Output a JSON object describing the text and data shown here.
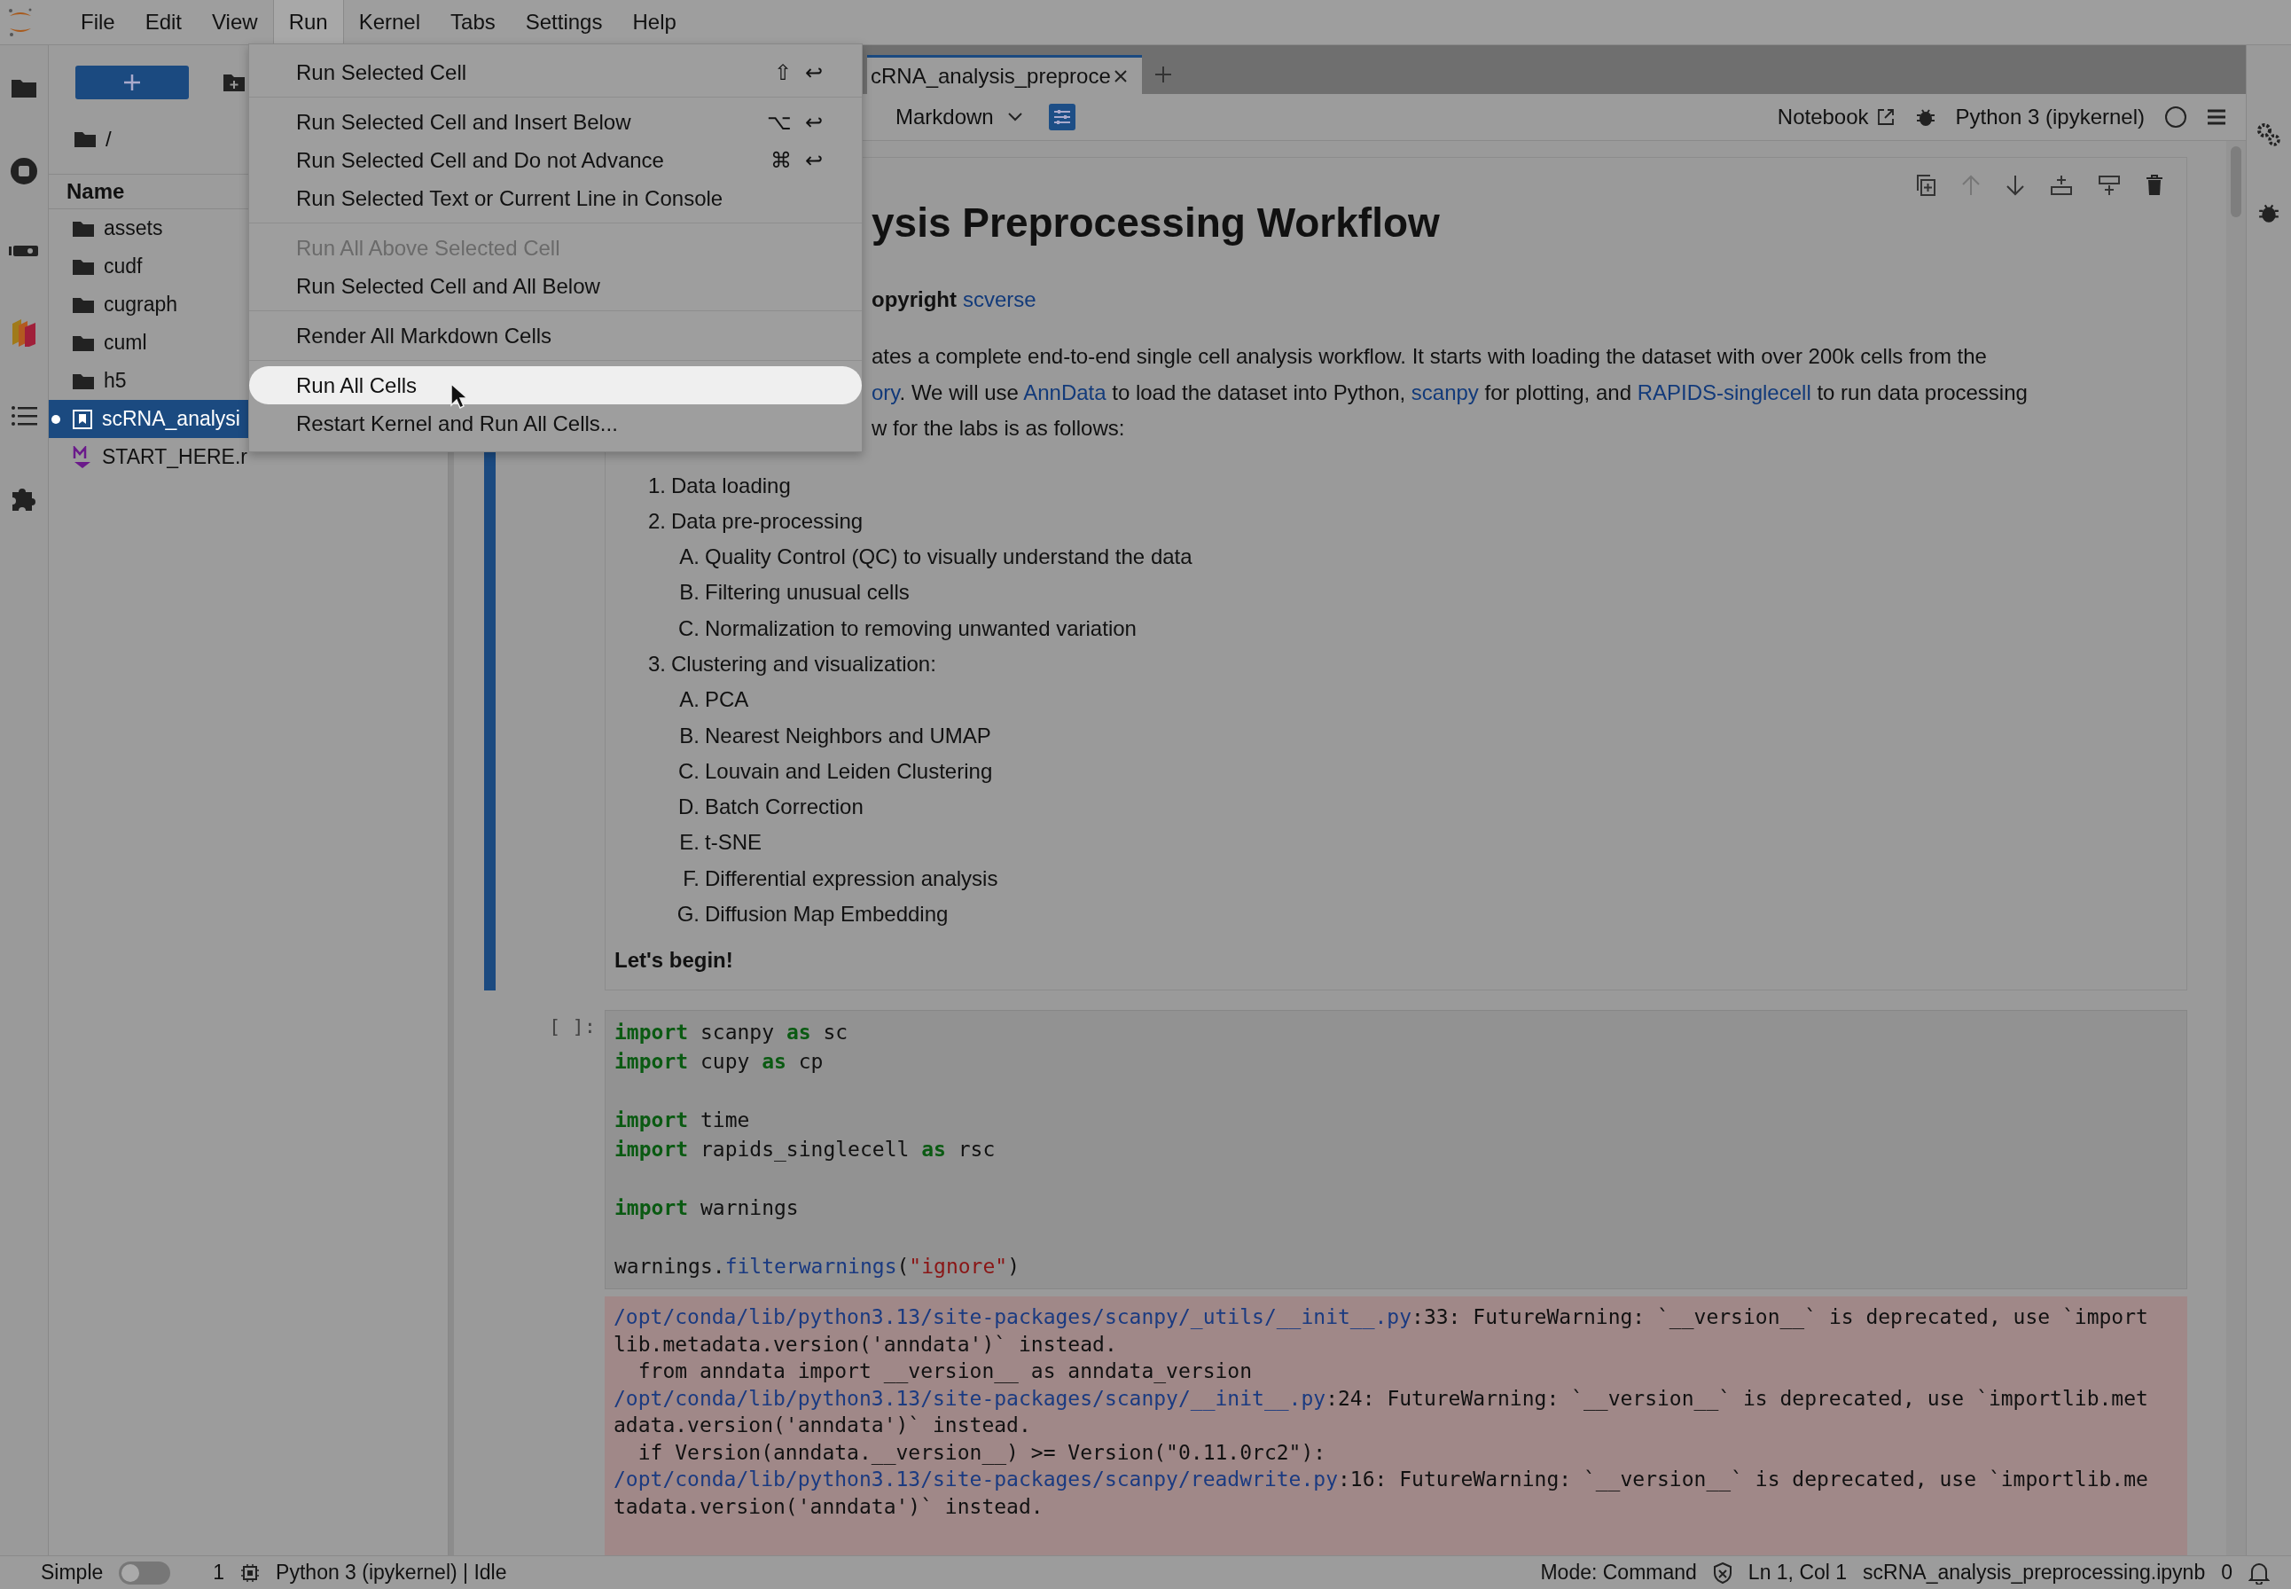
{
  "menubar": {
    "items": [
      {
        "label": "File",
        "selected": false
      },
      {
        "label": "Edit",
        "selected": false
      },
      {
        "label": "View",
        "selected": false
      },
      {
        "label": "Run",
        "selected": true
      },
      {
        "label": "Kernel",
        "selected": false
      },
      {
        "label": "Tabs",
        "selected": false
      },
      {
        "label": "Settings",
        "selected": false
      },
      {
        "label": "Help",
        "selected": false
      }
    ]
  },
  "run_menu": {
    "groups": [
      {
        "items": [
          {
            "label": "Run Selected Cell",
            "shortcut": "⇧ ↩",
            "disabled": false,
            "selected": false
          }
        ]
      },
      {
        "items": [
          {
            "label": "Run Selected Cell and Insert Below",
            "shortcut": "⌥ ↩",
            "disabled": false,
            "selected": false
          },
          {
            "label": "Run Selected Cell and Do not Advance",
            "shortcut": "⌘ ↩",
            "disabled": false,
            "selected": false
          },
          {
            "label": "Run Selected Text or Current Line in Console",
            "disabled": false,
            "selected": false
          }
        ]
      },
      {
        "items": [
          {
            "label": "Run All Above Selected Cell",
            "disabled": true,
            "selected": false
          },
          {
            "label": "Run Selected Cell and All Below",
            "disabled": false,
            "selected": false
          }
        ]
      },
      {
        "items": [
          {
            "label": "Render All Markdown Cells",
            "disabled": false,
            "selected": false
          }
        ]
      },
      {
        "items": [
          {
            "label": "Run All Cells",
            "disabled": false,
            "selected": true
          },
          {
            "label": "Restart Kernel and Run All Cells...",
            "disabled": false,
            "selected": false
          }
        ]
      }
    ]
  },
  "file_browser": {
    "path": "/",
    "column": "Name",
    "items": [
      {
        "name": "assets",
        "kind": "folder",
        "selected": false
      },
      {
        "name": "cudf",
        "kind": "folder",
        "selected": false
      },
      {
        "name": "cugraph",
        "kind": "folder",
        "selected": false
      },
      {
        "name": "cuml",
        "kind": "folder",
        "selected": false
      },
      {
        "name": "h5",
        "kind": "folder",
        "selected": false
      },
      {
        "name": "scRNA_analysi",
        "kind": "notebook",
        "selected": true
      },
      {
        "name": "START_HERE.r",
        "kind": "markdown",
        "selected": false
      }
    ]
  },
  "tab": {
    "title": "cRNA_analysis_preproce"
  },
  "toolbar": {
    "cell_type": "Markdown",
    "notebook_label": "Notebook",
    "kernel": "Python 3 (ipykernel)"
  },
  "markdown_cell": {
    "heading": "ysis Preprocessing Workflow",
    "copyright": [
      {
        "text": "opyright",
        "kind": "bold"
      },
      {
        "text": "scverse",
        "kind": "link"
      }
    ],
    "paragraph_lines": [
      [
        {
          "text": "ates a complete end-to-end single cell analysis workflow. It starts with loading the dataset with over 200k cells from the",
          "kind": "text"
        }
      ],
      [
        {
          "text": "ory",
          "kind": "link"
        },
        {
          "text": ". We will use ",
          "kind": "text"
        },
        {
          "text": "AnnData",
          "kind": "link"
        },
        {
          "text": " to load the dataset into Python, ",
          "kind": "text"
        },
        {
          "text": "scanpy",
          "kind": "link"
        },
        {
          "text": " for plotting, and ",
          "kind": "text"
        },
        {
          "text": "RAPIDS-singlecell",
          "kind": "link"
        },
        {
          "text": " to run data processing",
          "kind": "text"
        }
      ],
      [
        {
          "text": "w for the labs is as follows:",
          "kind": "text"
        }
      ]
    ],
    "list": [
      {
        "marker": "1.",
        "text": "Data loading"
      },
      {
        "marker": "2.",
        "text": "Data pre-processing",
        "children": [
          {
            "marker": "A.",
            "text": "Quality Control (QC) to visually understand the data"
          },
          {
            "marker": "B.",
            "text": "Filtering unusual cells"
          },
          {
            "marker": "C.",
            "text": "Normalization to removing unwanted variation"
          }
        ]
      },
      {
        "marker": "3.",
        "text": "Clustering and visualization:",
        "children": [
          {
            "marker": "A.",
            "text": "PCA"
          },
          {
            "marker": "B.",
            "text": "Nearest Neighbors and UMAP"
          },
          {
            "marker": "C.",
            "text": "Louvain and Leiden Clustering"
          },
          {
            "marker": "D.",
            "text": "Batch Correction"
          },
          {
            "marker": "E.",
            "text": "t-SNE"
          },
          {
            "marker": "F.",
            "text": "Differential expression analysis"
          },
          {
            "marker": "G.",
            "text": "Diffusion Map Embedding"
          }
        ]
      }
    ],
    "closing": "Let's begin!"
  },
  "code_cell": {
    "prompt": "[ ]:",
    "lines": [
      {
        "gap_before": false,
        "tokens": [
          {
            "text": "import",
            "kind": "keyword"
          },
          {
            "text": " scanpy ",
            "kind": "plain"
          },
          {
            "text": "as",
            "kind": "keyword"
          },
          {
            "text": " sc",
            "kind": "plain"
          }
        ]
      },
      {
        "gap_before": false,
        "tokens": [
          {
            "text": "import",
            "kind": "keyword"
          },
          {
            "text": " cupy ",
            "kind": "plain"
          },
          {
            "text": "as",
            "kind": "keyword"
          },
          {
            "text": " cp",
            "kind": "plain"
          }
        ]
      },
      {
        "gap_before": true,
        "tokens": [
          {
            "text": "import",
            "kind": "keyword"
          },
          {
            "text": " time",
            "kind": "plain"
          }
        ]
      },
      {
        "gap_before": false,
        "tokens": [
          {
            "text": "import",
            "kind": "keyword"
          },
          {
            "text": " rapids_singlecell ",
            "kind": "plain"
          },
          {
            "text": "as",
            "kind": "keyword"
          },
          {
            "text": " rsc",
            "kind": "plain"
          }
        ]
      },
      {
        "gap_before": true,
        "tokens": [
          {
            "text": "import",
            "kind": "keyword"
          },
          {
            "text": " warnings",
            "kind": "plain"
          }
        ]
      },
      {
        "gap_before": true,
        "tokens": [
          {
            "text": "warnings.",
            "kind": "plain"
          },
          {
            "text": "filterwarnings",
            "kind": "function"
          },
          {
            "text": "(",
            "kind": "plain"
          },
          {
            "text": "\"ignore\"",
            "kind": "string"
          },
          {
            "text": ")",
            "kind": "plain"
          }
        ]
      }
    ],
    "output": [
      [
        {
          "text": "/opt/conda/lib/python3.13/site-packages/scanpy/_utils/__init__.py",
          "kind": "path"
        },
        {
          "text": ":33: FutureWarning: `__version__` is deprecated, use `import",
          "kind": "text"
        }
      ],
      [
        {
          "text": "lib.metadata.version('anndata')` instead.",
          "kind": "text"
        }
      ],
      [
        {
          "text": "  from anndata import __version__ as anndata_version",
          "kind": "text"
        }
      ],
      [
        {
          "text": "/opt/conda/lib/python3.13/site-packages/scanpy/__init__.py",
          "kind": "path"
        },
        {
          "text": ":24: FutureWarning: `__version__` is deprecated, use `importlib.met",
          "kind": "text"
        }
      ],
      [
        {
          "text": "adata.version('anndata')` instead.",
          "kind": "text"
        }
      ],
      [
        {
          "text": "  if Version(anndata.__version__) >= Version(\"0.11.0rc2\"):",
          "kind": "text"
        }
      ],
      [
        {
          "text": "/opt/conda/lib/python3.13/site-packages/scanpy/readwrite.py",
          "kind": "path"
        },
        {
          "text": ":16: FutureWarning: `__version__` is deprecated, use `importlib.me",
          "kind": "text"
        }
      ],
      [
        {
          "text": "tadata.version('anndata')` instead.",
          "kind": "text"
        }
      ]
    ]
  },
  "status_bar": {
    "mode_label": "Simple",
    "simple_on": false,
    "count": "1",
    "kernel_status": "Python 3 (ipykernel) | Idle",
    "mode": "Mode: Command",
    "position": "Ln 1, Col 1",
    "file": "scRNA_analysis_preprocessing.ipynb",
    "notifications": "0"
  }
}
